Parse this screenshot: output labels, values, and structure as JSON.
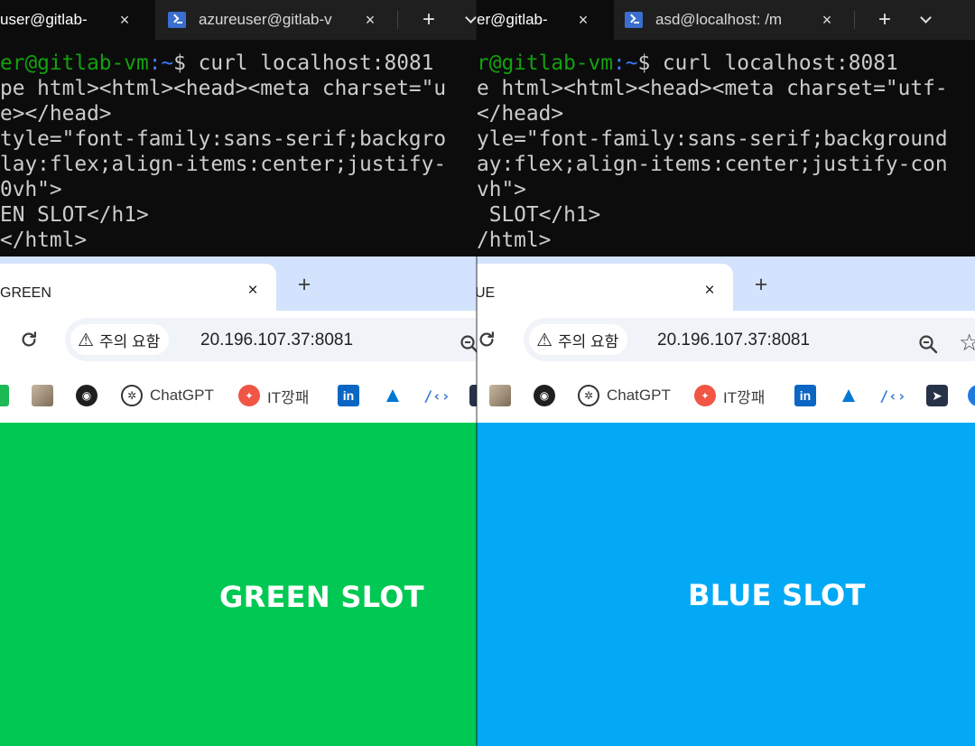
{
  "left": {
    "terminal": {
      "tabs": [
        {
          "label": "user@gitlab-",
          "active": true
        },
        {
          "label": "azureuser@gitlab-v",
          "active": false
        }
      ],
      "prompt_user": "er@gitlab-vm",
      "prompt_path": ":~",
      "prompt_symbol": "$",
      "command": " curl localhost:8081",
      "output": [
        "pe html><html><head><meta charset=\"u",
        "e></head>",
        "tyle=\"font-family:sans-serif;backgro",
        "lay:flex;align-items:center;justify-",
        "0vh\">",
        "EN SLOT</h1>",
        "</html>"
      ]
    },
    "browser": {
      "tab_title": "GREEN",
      "security_chip": "주의 요함",
      "url": "20.196.107.37:8081",
      "bookmarks": [
        "ChatGPT",
        "IT깡패"
      ],
      "page_title": "GREEN SLOT",
      "page_color": "#00c853"
    }
  },
  "right": {
    "terminal": {
      "tabs": [
        {
          "label": "er@gitlab-",
          "active": true
        },
        {
          "label": "asd@localhost: /m",
          "active": false
        }
      ],
      "prompt_user": "r@gitlab-vm",
      "prompt_path": ":~",
      "prompt_symbol": "$",
      "command": " curl localhost:8081",
      "output": [
        "e html><html><head><meta charset=\"utf-",
        "</head>",
        "yle=\"font-family:sans-serif;background",
        "ay:flex;align-items:center;justify-con",
        "vh\">",
        " SLOT</h1>",
        "/html>"
      ]
    },
    "browser": {
      "tab_title": "UE",
      "security_chip": "주의 요함",
      "url": "20.196.107.37:8081",
      "bookmarks": [
        "ChatGPT",
        "IT깡패"
      ],
      "page_title": "BLUE SLOT",
      "page_color": "#03a9f4"
    }
  },
  "icons": {
    "close": "×",
    "plus": "+",
    "warning": "⚠",
    "star": "☆"
  }
}
